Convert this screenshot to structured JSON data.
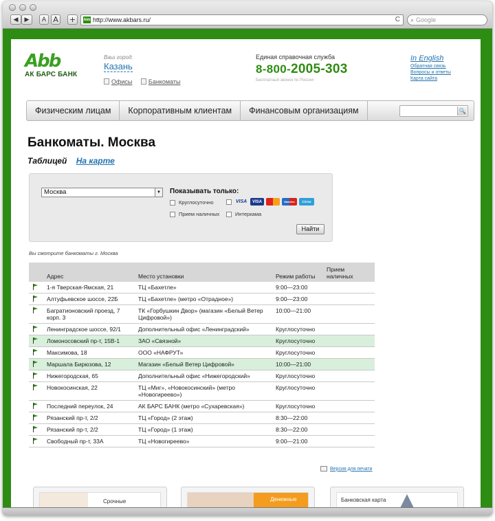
{
  "browser": {
    "url": "http://www.akbars.ru/",
    "favicon_text": "Abb",
    "search_placeholder": "Google",
    "btn_back": "◀",
    "btn_fwd": "▶",
    "btn_text_small": "A",
    "btn_text_large": "A",
    "btn_add": "+",
    "reload": "C"
  },
  "header": {
    "logo_mark": "Abb",
    "logo_text": "АК БАРС БАНК",
    "city_label": "Ваш город:",
    "city_name": "Казань",
    "link_offices": "Офисы",
    "link_atms": "Банкоматы",
    "help_label": "Единая справочная служба",
    "help_phone_prefix": "8-800-",
    "help_phone_main": "2005-303",
    "help_note": "Бесплатный звонок по России",
    "link_english": "In English",
    "link_feedback": "Обратная связь",
    "link_faq": "Вопросы и ответы",
    "link_sitemap": "Карта сайта"
  },
  "menu": {
    "items": [
      "Физическим лицам",
      "Корпоративным клиентам",
      "Финансовым организациям"
    ],
    "search_icon": "magnifier-icon"
  },
  "main": {
    "title": "Банкоматы. Москва",
    "view_table": "Таблицей",
    "view_map": "На карте",
    "filter": {
      "city_selected": "Москва",
      "show_only_label": "Показывать только:",
      "opt_24h": "Круглосуточно",
      "opt_cash": "Прием наличных",
      "opt_visa": "",
      "opt_intercom": "Интеркама",
      "find_button": "Найти",
      "cards": [
        "VISA",
        "VISA",
        "MC",
        "Maestro",
        "Cirrus"
      ]
    },
    "viewing_note": "Вы смотрите банкоматы г. Москва",
    "table": {
      "headers": [
        "Адрес",
        "Место установки",
        "Режим работы",
        "Прием наличных"
      ],
      "rows": [
        {
          "address": "1-я Тверская-Ямская, 21",
          "place": "ТЦ «Бахетле»",
          "hours": "9:00—23:00",
          "highlight": false
        },
        {
          "address": "Алтуфьевское шоссе, 22Б",
          "place": "ТЦ «Бахетле» (метро «Отрадное»)",
          "hours": "9:00—23:00",
          "highlight": false
        },
        {
          "address": "Багратионовский проезд, 7 корп. 3",
          "place": "ТК «Горбушкин Двор» (магазин «Белый Ветер Цифровой»)",
          "hours": "10:00—21:00",
          "highlight": false
        },
        {
          "address": "Ленинградское шоссе, 92/1",
          "place": "Дополнительный офис «Ленинградский»",
          "hours": "Круглосуточно",
          "highlight": false
        },
        {
          "address": "Ломоносовский пр-т, 15В-1",
          "place": "ЗАО «Связной»",
          "hours": "Круглосуточно",
          "highlight": true
        },
        {
          "address": "Максимова, 18",
          "place": "ООО «НАФРУТ»",
          "hours": "Круглосуточно",
          "highlight": false
        },
        {
          "address": "Маршала Бирюзова, 12",
          "place": "Магазин «Белый Ветер Цифровой»",
          "hours": "10:00—21:00",
          "highlight": true
        },
        {
          "address": "Нижегородская, 65",
          "place": "Дополнительный офис «Нижегородский»",
          "hours": "Круглосуточно",
          "highlight": false
        },
        {
          "address": "Новокосинская, 22",
          "place": "ТЦ «Миг», «Новокосинский» (метро «Новогиреево»)",
          "hours": "Круглосуточно",
          "highlight": false
        },
        {
          "address": "Последний переулок, 24",
          "place": "АК БАРС БАНК (метро «Сухаревская»)",
          "hours": "Круглосуточно",
          "highlight": false
        },
        {
          "address": "Рязанский пр-т, 2/2",
          "place": "ТЦ «Город» (2 этаж)",
          "hours": "8:30—22:00",
          "highlight": false
        },
        {
          "address": "Рязанский пр-т, 2/2",
          "place": "ТЦ «Город» (1 этаж)",
          "hours": "8:30—22:00",
          "highlight": false
        },
        {
          "address": "Свободный пр-т, 33А",
          "place": "ТЦ «Новогиреево»",
          "hours": "9:00—21:00",
          "highlight": false
        }
      ]
    },
    "print_link": "Версия для печати",
    "promos": [
      "Срочные",
      "Денежные",
      "Банковская карта"
    ]
  },
  "colors": {
    "brand_green": "#2d8c12",
    "link_blue": "#2373b0",
    "highlight_row": "#d8efdc"
  }
}
